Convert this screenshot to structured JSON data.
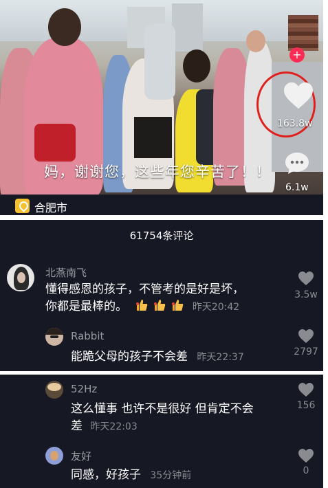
{
  "video": {
    "caption": "妈，谢谢您，这些年您辛苦了！！",
    "location": "合肥市",
    "like_count": "163.8w",
    "comment_count": "6.1w",
    "like_highlight_color": "#e0201c"
  },
  "comments_header": {
    "title": "61754条评论"
  },
  "comments": [
    {
      "user": "北燕南飞",
      "text_line1": "懂得感恩的孩子，不管考的是好是坏，",
      "text_line2": "你都是最棒的。",
      "emoji": [
        "thumbs-up",
        "thumbs-up",
        "thumbs-up"
      ],
      "time": "昨天20:42",
      "likes": "3.5w"
    },
    {
      "user": "Rabbit",
      "text": "能跪父母的孩子不会差",
      "time": "昨天22:37",
      "likes": "2797"
    },
    {
      "user": "52Hz",
      "text_line1": "这么懂事 也许不是很好 但肯定不会",
      "text_line2": "差",
      "time": "昨天22:03",
      "likes": "156"
    },
    {
      "user": "友好",
      "text": "同感，好孩子",
      "time": "35分钟前",
      "likes": "0"
    }
  ]
}
